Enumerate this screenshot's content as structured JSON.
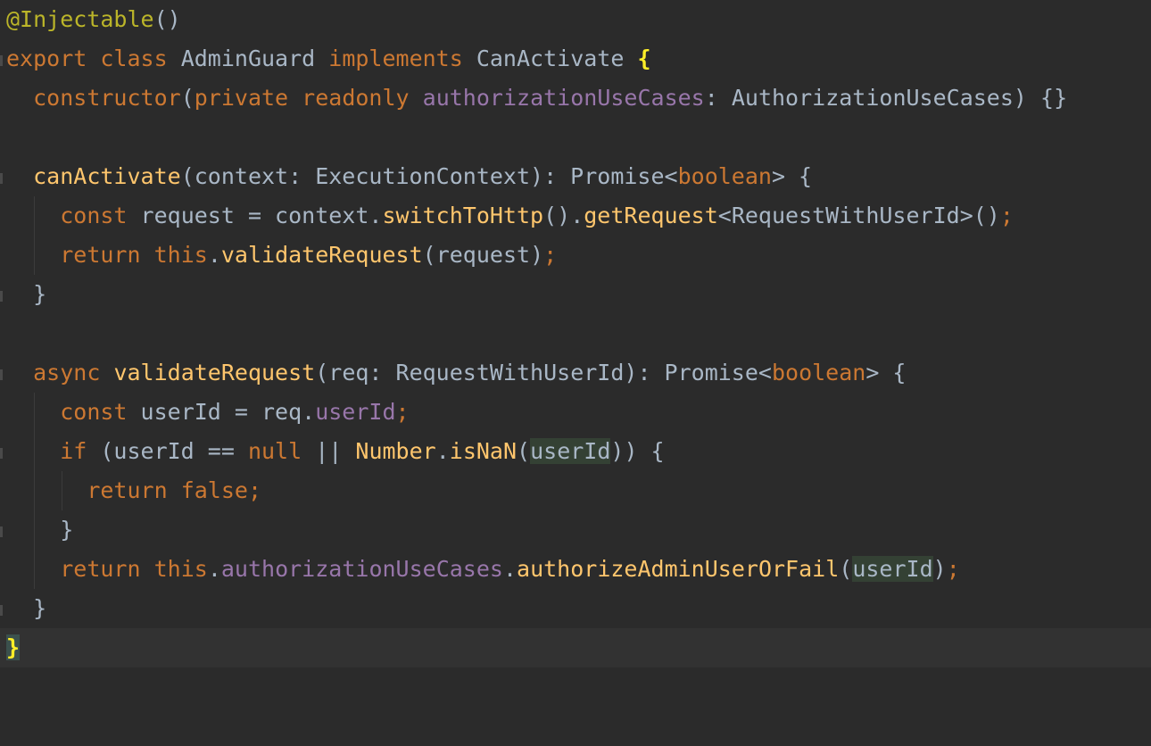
{
  "editor": {
    "language": "typescript",
    "colors": {
      "background": "#2b2b2b",
      "keyword": "#cc7832",
      "function": "#ffc66d",
      "field": "#9876aa",
      "annotation": "#bbb529",
      "text": "#a9b7c6",
      "matched_brace": "#ffef28",
      "usage_highlight": "#344134"
    },
    "lines": [
      {
        "tokens": [
          "@Injectable",
          "()"
        ]
      },
      {
        "tokens": [
          "export",
          " ",
          "class",
          " AdminGuard ",
          "implements",
          " CanActivate ",
          "{"
        ]
      },
      {
        "tokens": [
          "  ",
          "constructor",
          "(",
          "private",
          " ",
          "readonly",
          " ",
          "authorizationUseCases",
          ": AuthorizationUseCases) {}"
        ]
      },
      {
        "tokens": [
          ""
        ]
      },
      {
        "tokens": [
          "  ",
          "canActivate",
          "(context: ExecutionContext): Promise<",
          "boolean",
          "> {"
        ]
      },
      {
        "tokens": [
          "    ",
          "const",
          " request = context.",
          "switchToHttp",
          "().",
          "getRequest",
          "<RequestWithUserId>()",
          ";"
        ]
      },
      {
        "tokens": [
          "    ",
          "return",
          " ",
          "this",
          ".",
          "validateRequest",
          "(request)",
          ";"
        ]
      },
      {
        "tokens": [
          "  }"
        ]
      },
      {
        "tokens": [
          ""
        ]
      },
      {
        "tokens": [
          "  ",
          "async",
          " ",
          "validateRequest",
          "(req: RequestWithUserId): Promise<",
          "boolean",
          "> {"
        ]
      },
      {
        "tokens": [
          "    ",
          "const",
          " userId = req.",
          "userId",
          ";"
        ]
      },
      {
        "tokens": [
          "    ",
          "if",
          " (userId == ",
          "null",
          " || ",
          "Number",
          ".",
          "isNaN",
          "(",
          "userId",
          ")) {"
        ]
      },
      {
        "tokens": [
          "      ",
          "return",
          " ",
          "false",
          ";"
        ]
      },
      {
        "tokens": [
          "    }"
        ]
      },
      {
        "tokens": [
          "    ",
          "return",
          " ",
          "this",
          ".",
          "authorizationUseCases",
          ".",
          "authorizeAdminUserOrFail",
          "(",
          "userId",
          ")",
          ";"
        ]
      },
      {
        "tokens": [
          "  }"
        ]
      },
      {
        "tokens": [
          "}"
        ]
      }
    ]
  }
}
